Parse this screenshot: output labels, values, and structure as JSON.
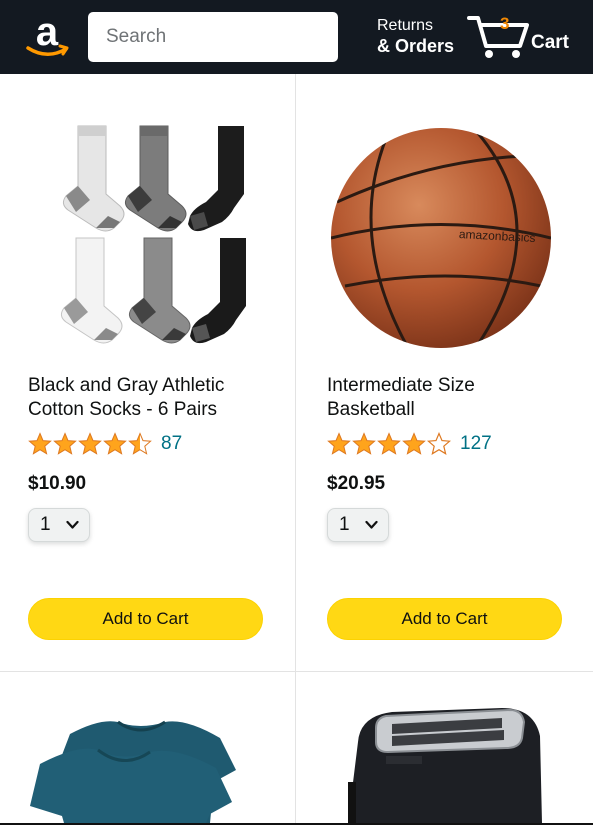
{
  "header": {
    "logo_icon": "amazon-logo",
    "search": {
      "placeholder": "Search",
      "value": "",
      "icon": "search-icon"
    },
    "returns": {
      "line1": "Returns",
      "line2": "& Orders"
    },
    "cart": {
      "count": "3",
      "label": "Cart",
      "icon": "cart-icon"
    }
  },
  "products": [
    {
      "title": "Black and Gray Athletic Cotton Socks - 6 Pairs",
      "rating": 4.5,
      "review_count": "87",
      "price": "$10.90",
      "quantity": "1",
      "add_label": "Add to Cart",
      "image": "socks-image"
    },
    {
      "title": "Intermediate Size Basketball",
      "rating": 4.0,
      "review_count": "127",
      "price": "$20.95",
      "quantity": "1",
      "add_label": "Add to Cart",
      "image": "basketball-image"
    }
  ],
  "basketball_brand": "amazonbasics",
  "partial_products": [
    {
      "image": "tshirt-image"
    },
    {
      "image": "toaster-image"
    }
  ],
  "colors": {
    "header_bg": "#131921",
    "search_button": "#febd69",
    "cart_count": "#f08804",
    "add_button": "#ffd814",
    "star": "#ffa41c",
    "link": "#007185"
  }
}
